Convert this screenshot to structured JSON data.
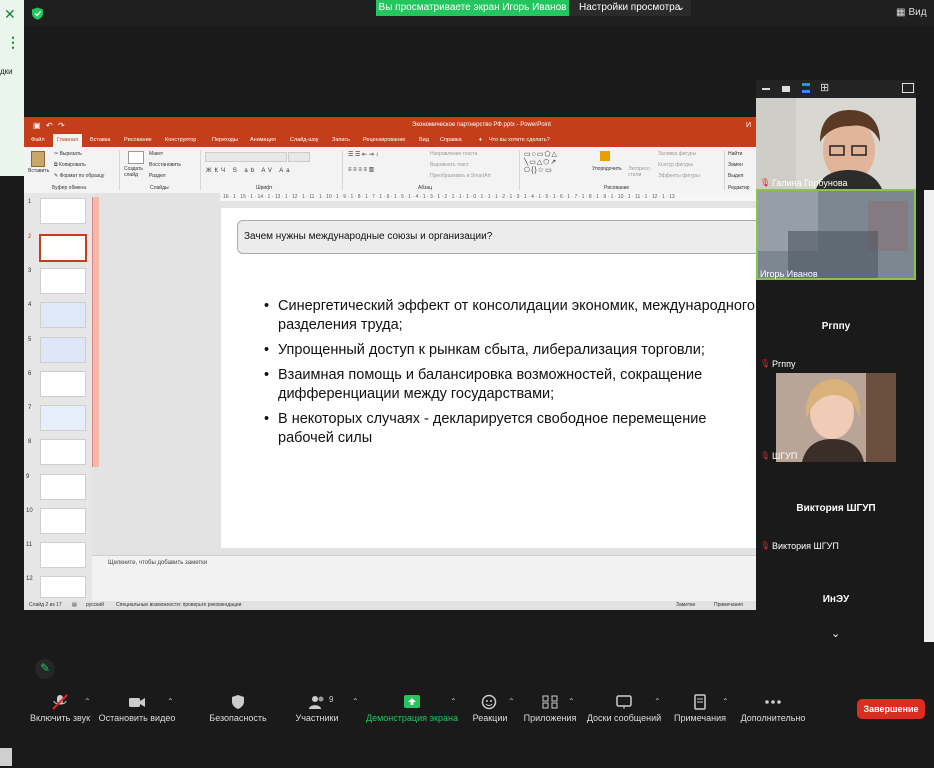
{
  "topbar": {
    "banner": "Вы просматриваете экран Игорь Иванов",
    "view_settings": "Настройки просмотра",
    "view_button": "Вид",
    "left_close": "✕",
    "left_more": "⋮",
    "left_partial": "дки"
  },
  "ppt": {
    "window_title": "Экономическое партнерство РФ.pptx - PowerPoint",
    "user_partial": "И",
    "tabs": [
      "Файл",
      "Главная",
      "Вставка",
      "Рисование",
      "Конструктор",
      "Переходы",
      "Анимация",
      "Слайд-шоу",
      "Запись",
      "Рецензирование",
      "Вид",
      "Справка",
      "Что вы хотите сделать?"
    ],
    "active_tab": "Главная",
    "ribbon": {
      "paste": "Вставить",
      "cut": "Вырезать",
      "copy": "Копировать",
      "format_painter": "Формат по образцу",
      "clipboard_group": "Буфер обмена",
      "new_slide": "Создать слайд",
      "layout": "Макет",
      "reset": "Восстановить",
      "section": "Раздел",
      "slides_group": "Слайды",
      "font_group": "Шрифт",
      "text_direction": "Направление текста",
      "align_text": "Выровнять текст",
      "smartart": "Преобразовать в SmartArt",
      "paragraph_group": "Абзац",
      "arrange": "Упорядочить",
      "quick_styles": "Экспресс-стили",
      "shape_fill": "Заливка фигуры",
      "shape_outline": "Контур фигуры",
      "shape_effects": "Эффекты фигуры",
      "drawing_group": "Рисование",
      "find": "Найти",
      "replace": "Замен",
      "select": "Выдел",
      "editing_group": "Редактир"
    },
    "ruler": "· 16 · 1 · 15 · 1 · 14 · 1 · 13 · 1 · 12 · 1 · 11 · 1 · 10 · 1 · 9 · 1 · 8 · 1 · 7 · 1 · 6 · 1 · 5 · 1 · 4 · 1 · 3 · 1 · 2 · 1 · 1 · 1 · 0 · 1 · 1 · 1 · 2 · 1 · 3 · 1 · 4 · 1 · 5 · 1 · 6 · 1 · 7 · 1 · 8 · 1 · 9 · 1 · 10 · 1 · 11 · 1 · 12 · 1 · 13",
    "slide_numbers": [
      "1",
      "2",
      "3",
      "4",
      "5",
      "6",
      "7",
      "8",
      "9",
      "10",
      "11",
      "12"
    ],
    "slide_title": "Зачем нужны международные союзы и организации?",
    "bullets": [
      "Синергетический эффект от консолидации экономик, международного разделения труда;",
      "Упрощенный доступ к рынкам сбыта, либерализация торговли;",
      "Взаимная помощь и балансировка возможностей, сокращение дифференциации между государствами;",
      "В некоторых случаях - декларируется свободное перемещение рабочей силы"
    ],
    "notes_placeholder": "Щелкните, чтобы добавить заметки",
    "status": {
      "slide_count": "Слайд 2 из 17",
      "language": "русский",
      "accessibility": "Специальные возможности: проверьте рекомендации",
      "notes": "Заметки",
      "comments": "Примечания"
    }
  },
  "participants": [
    {
      "name": "Галина Горбунова",
      "muted": true
    },
    {
      "name": "Игорь Иванов",
      "muted": false
    },
    {
      "name": "Ргппу",
      "muted": true,
      "big_label": "Ргппу"
    },
    {
      "name": "ШГУП",
      "muted": true
    },
    {
      "name": "Виктория ШГУП",
      "muted": true,
      "big_label": "Виктория ШГУП"
    },
    {
      "name": "ИнЭУ",
      "big_label": "ИнЭУ"
    }
  ],
  "toolbar": {
    "unmute": "Включить звук",
    "stop_video": "Остановить видео",
    "security": "Безопасность",
    "participants": "Участники",
    "participants_count": "9",
    "share_screen": "Демонстрация экрана",
    "reactions": "Реакции",
    "apps": "Приложения",
    "whiteboards": "Доски сообщений",
    "notes": "Примечания",
    "more": "Дополнительно",
    "end": "Завершение"
  },
  "colors": {
    "zoom_green": "#22c55e",
    "ppt_red": "#c43e1c",
    "end_red": "#d92d20",
    "active_speaker_border": "#8bc34a"
  }
}
